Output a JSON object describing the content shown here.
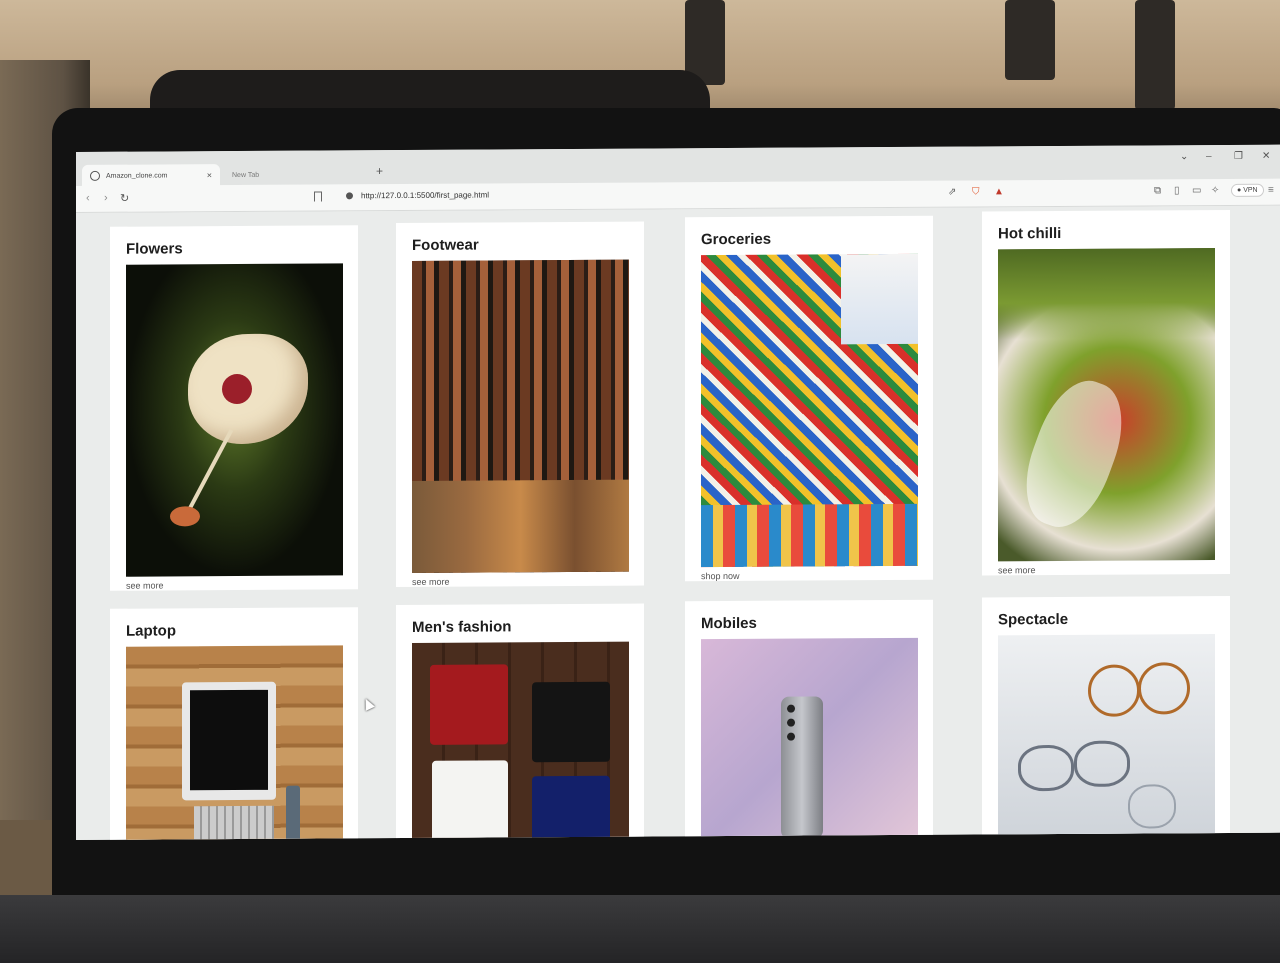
{
  "browser": {
    "tabs": [
      {
        "label": "Amazon_clone.com",
        "active": true
      },
      {
        "label": "New Tab",
        "active": false
      }
    ],
    "new_tab_symbol": "+",
    "close_symbol": "×",
    "url": "http://127.0.0.1:5500/first_page.html",
    "vpn_label": "VPN",
    "nav": {
      "back": "‹",
      "forward": "›",
      "reload": "↻"
    },
    "window_controls": {
      "dropdown": "⌄",
      "minimize": "–",
      "restore": "❐",
      "close": "✕"
    }
  },
  "cards": [
    {
      "title": "Flowers",
      "link": "see more",
      "image": "hibiscus flower"
    },
    {
      "title": "Footwear",
      "link": "see more",
      "image": "sandals rack"
    },
    {
      "title": "Groceries",
      "link": "shop now",
      "image": "grocery shelves"
    },
    {
      "title": "Hot chilli",
      "link": "see more",
      "image": "chilli peppers"
    },
    {
      "title": "Laptop",
      "link": "",
      "image": "laptop on desk"
    },
    {
      "title": "Men's fashion",
      "link": "",
      "image": "folded t-shirts"
    },
    {
      "title": "Mobiles",
      "link": "",
      "image": "smartphone"
    },
    {
      "title": "Spectacle",
      "link": "",
      "image": "eyeglasses display"
    }
  ],
  "colors": {
    "page_bg": "#eaeceb",
    "card_bg": "#ffffff",
    "title_text": "#1e1e1e"
  }
}
